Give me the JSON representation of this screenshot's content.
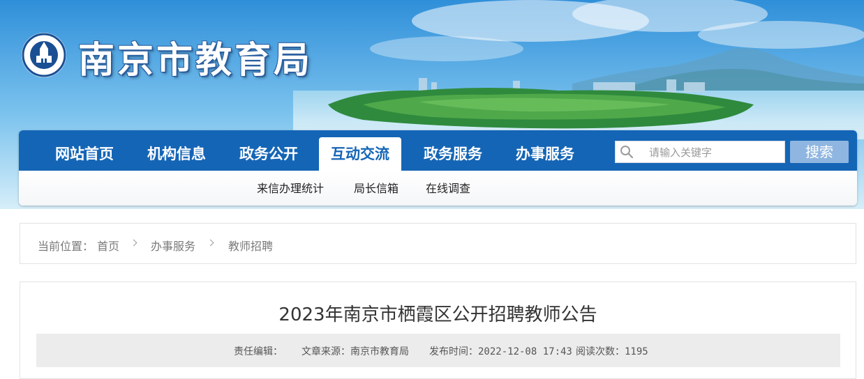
{
  "header": {
    "site_title": "南京市教育局",
    "logo_icon": "nanjing-education-emblem-icon"
  },
  "nav": {
    "items": [
      {
        "label": "网站首页",
        "active": false
      },
      {
        "label": "机构信息",
        "active": false
      },
      {
        "label": "政务公开",
        "active": false
      },
      {
        "label": "互动交流",
        "active": true
      },
      {
        "label": "政务服务",
        "active": false
      },
      {
        "label": "办事服务",
        "active": false
      }
    ],
    "search": {
      "placeholder": "请输入关键字",
      "value": "",
      "button_label": "搜索",
      "icon": "search-icon"
    },
    "sub_items": [
      {
        "label": "来信办理统计"
      },
      {
        "label": "局长信箱"
      },
      {
        "label": "在线调查"
      }
    ],
    "colors": {
      "bar": "#1465b6",
      "search_button": "#8fb6e0"
    }
  },
  "breadcrumb": {
    "prefix": "当前位置：",
    "items": [
      "首页",
      "办事服务",
      "教师招聘"
    ]
  },
  "article": {
    "title": "2023年南京市栖霞区公开招聘教师公告",
    "meta": {
      "editor_label": "责任编辑：",
      "editor": "",
      "source_label": "文章来源：",
      "source": "南京市教育局",
      "time_label": "发布时间：",
      "time": "2022-12-08 17:43",
      "reads_label": "阅读次数：",
      "reads": "1195"
    }
  }
}
